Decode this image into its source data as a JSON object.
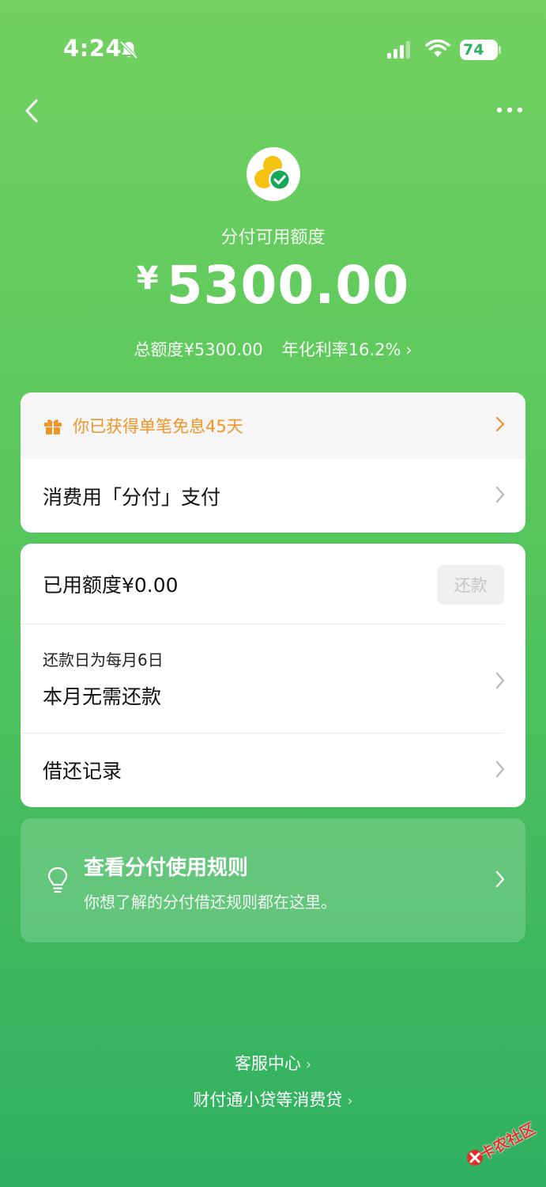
{
  "status_bar": {
    "time": "4:24",
    "battery": "74"
  },
  "header": {
    "available_label": "分付可用额度",
    "currency_symbol": "¥",
    "available_amount": "5300.00",
    "total_limit": "总额度¥5300.00",
    "annual_rate": "年化利率16.2%"
  },
  "promo": {
    "text": "你已获得单笔免息45天"
  },
  "pay": {
    "label": "消费用「分付」支付"
  },
  "repayment": {
    "used_label": "已用额度¥0.00",
    "repay_button": "还款",
    "due_day": "还款日为每月6日",
    "due_status": "本月无需还款",
    "records_label": "借还记录"
  },
  "rules": {
    "title": "查看分付使用规则",
    "subtitle": "你想了解的分付借还规则都在这里。"
  },
  "footer": {
    "customer_service": "客服中心",
    "lender_info": "财付通小贷等消费贷"
  },
  "watermark": {
    "text": "卡农社区"
  },
  "colors": {
    "accent_green": "#57c65c",
    "promo_orange": "#f0952a",
    "logo_yellow": "#f5c211",
    "watermark_red": "#e0302a"
  }
}
